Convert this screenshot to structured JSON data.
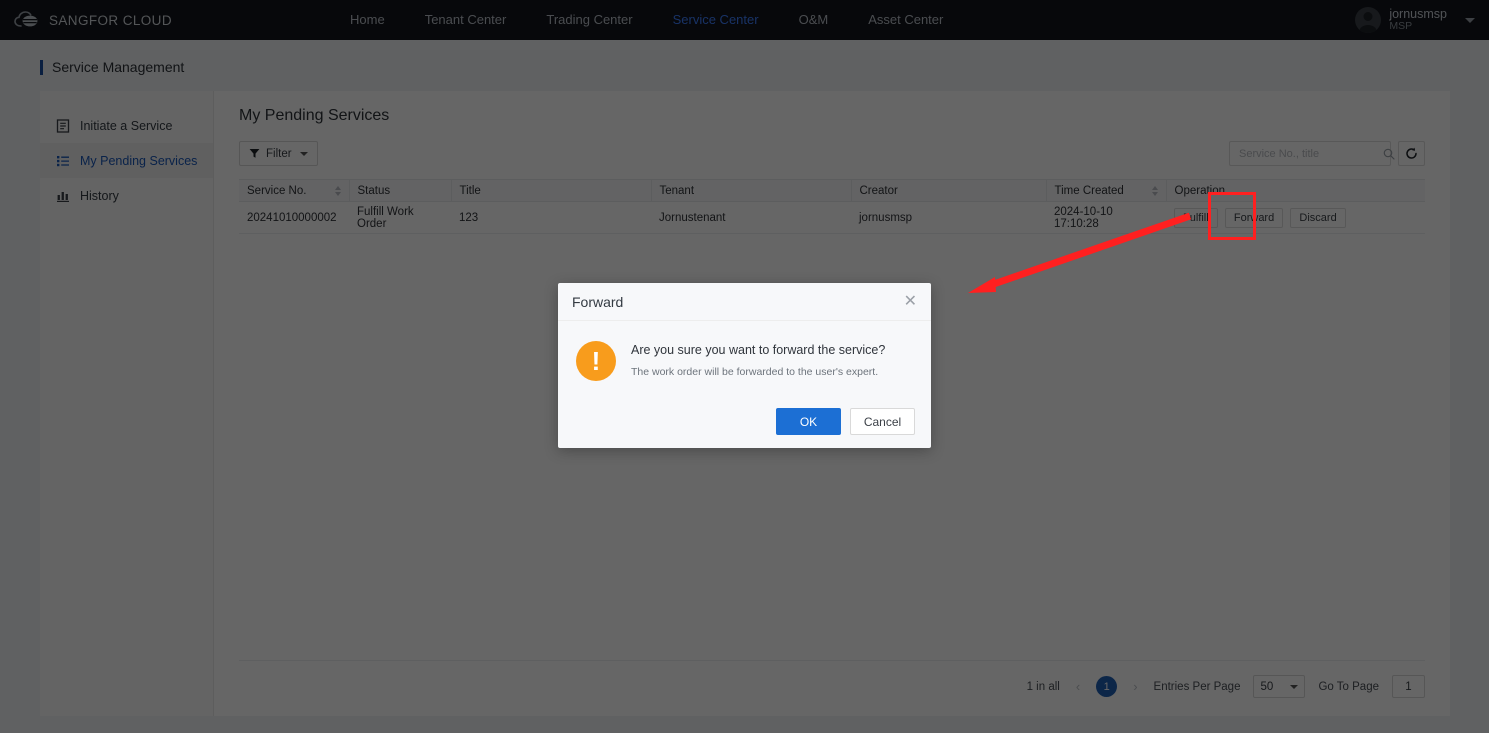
{
  "colors": {
    "nav_bg": "#12161c",
    "nav_active": "#3d7eff",
    "link": "#2767c9",
    "status_warning": "#e08a2c",
    "primary": "#1c6fd4",
    "warn_icon": "#f89c1c",
    "annotation": "#ff2020",
    "pager_active": "#1f5fb5"
  },
  "topnav": {
    "brand": "SANGFOR CLOUD",
    "brand_logo_icon": "cloud-logo-icon",
    "items": [
      {
        "label": "Home",
        "active": false
      },
      {
        "label": "Tenant Center",
        "active": false
      },
      {
        "label": "Trading Center",
        "active": false
      },
      {
        "label": "Service Center",
        "active": true
      },
      {
        "label": "O&M",
        "active": false
      },
      {
        "label": "Asset Center",
        "active": false
      }
    ],
    "user": {
      "name": "jornusmsp",
      "role": "MSP",
      "avatar_icon": "user-avatar-icon",
      "caret_icon": "chevron-down-icon"
    }
  },
  "breadcrumb": {
    "label": "Service Management"
  },
  "sidebar": {
    "items": [
      {
        "label": "Initiate a Service",
        "icon": "document-icon",
        "active": false
      },
      {
        "label": "My Pending Services",
        "icon": "list-icon",
        "active": true
      },
      {
        "label": "History",
        "icon": "bar-chart-icon",
        "active": false
      }
    ]
  },
  "main": {
    "title": "My Pending Services",
    "toolbar": {
      "filter_label": "Filter",
      "filter_icon": "funnel-icon",
      "filter_caret_icon": "caret-down-icon",
      "search_placeholder": "Service No., title",
      "search_value": "",
      "search_icon": "magnifier-icon",
      "refresh_icon": "refresh-icon"
    },
    "table": {
      "columns": [
        {
          "label": "Service No.",
          "sortable": true
        },
        {
          "label": "Status",
          "sortable": false
        },
        {
          "label": "Title",
          "sortable": false
        },
        {
          "label": "Tenant",
          "sortable": false
        },
        {
          "label": "Creator",
          "sortable": false
        },
        {
          "label": "Time Created",
          "sortable": true
        },
        {
          "label": "Operation",
          "sortable": false
        }
      ],
      "rows": [
        {
          "service_no": "20241010000002",
          "status": "Fulfill Work Order",
          "title": "123",
          "tenant": "Jornustenant",
          "creator": "jornusmsp",
          "time_created": "2024-10-10 17:10:28",
          "operations": [
            "Fulfill",
            "Forward",
            "Discard"
          ]
        }
      ]
    },
    "pagination": {
      "total_label": "1 in all",
      "prev_icon": "chevron-left-icon",
      "next_icon": "chevron-right-icon",
      "current_page": "1",
      "entries_label": "Entries Per Page",
      "entries_value": "50",
      "entries_caret_icon": "caret-down-icon",
      "goto_label": "Go To Page",
      "goto_value": "1"
    }
  },
  "annotations": {
    "highlight_target": "Forward",
    "arrow_from": "forward-button",
    "arrow_to": "forward-dialog"
  },
  "modal": {
    "title": "Forward",
    "close_icon": "close-icon",
    "warning_icon": "exclamation-icon",
    "question": "Are you sure you want to forward the service?",
    "description": "The work order will be forwarded to the user's expert.",
    "ok_label": "OK",
    "cancel_label": "Cancel"
  }
}
